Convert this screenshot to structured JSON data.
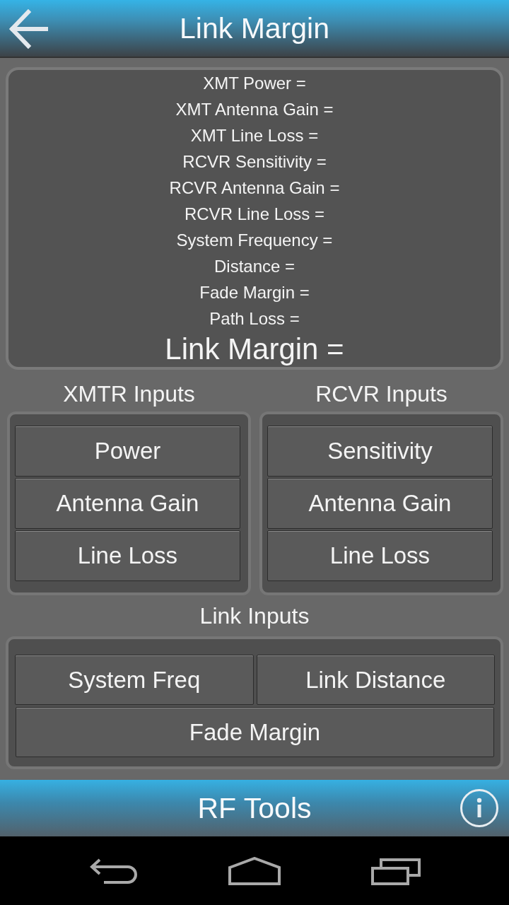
{
  "app_bar": {
    "title": "Link Margin"
  },
  "results": {
    "lines": [
      {
        "label": "XMT Power =",
        "kind": "detail"
      },
      {
        "label": "XMT Antenna Gain =",
        "kind": "detail"
      },
      {
        "label": "XMT Line Loss =",
        "kind": "detail"
      },
      {
        "label": "RCVR Sensitivity =",
        "kind": "detail"
      },
      {
        "label": "RCVR Antenna Gain =",
        "kind": "detail"
      },
      {
        "label": "RCVR Line Loss =",
        "kind": "detail"
      },
      {
        "label": "System Frequency =",
        "kind": "detail"
      },
      {
        "label": "Distance =",
        "kind": "detail"
      },
      {
        "label": "Fade Margin =",
        "kind": "detail"
      },
      {
        "label": "Path Loss =",
        "kind": "detail"
      },
      {
        "label": "Link Margin =",
        "kind": "total"
      }
    ]
  },
  "device_inputs": [
    {
      "heading": "XMTR Inputs",
      "buttons": [
        "Power",
        "Antenna Gain",
        "Line Loss"
      ]
    },
    {
      "heading": "RCVR Inputs",
      "buttons": [
        "Sensitivity",
        "Antenna Gain",
        "Line Loss"
      ]
    }
  ],
  "link_inputs": {
    "heading": "Link Inputs",
    "buttons": [
      {
        "label": "System Freq",
        "kind": "half"
      },
      {
        "label": "Link Distance",
        "kind": "half"
      },
      {
        "label": "Fade Margin",
        "kind": "full"
      }
    ]
  },
  "footer": {
    "title": "RF Tools"
  }
}
